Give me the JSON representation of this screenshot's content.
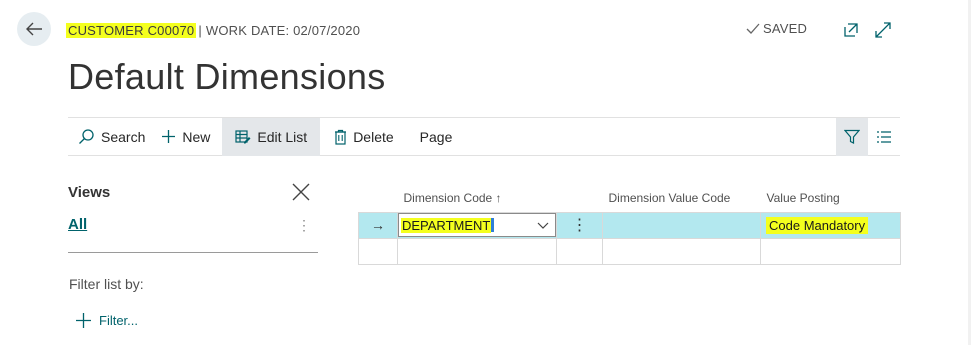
{
  "header": {
    "record_label": "CUSTOMER C00070",
    "separator": "|",
    "work_date": "WORK DATE: 02/07/2020",
    "status": "SAVED",
    "highlight_color": "#f4ff1e"
  },
  "page": {
    "title": "Default Dimensions"
  },
  "toolbar": {
    "search_label": "Search",
    "new_label": "New",
    "edit_list_label": "Edit List",
    "delete_label": "Delete",
    "page_label": "Page"
  },
  "views": {
    "title": "Views",
    "items": [
      {
        "label": "All",
        "dots": "⋮"
      }
    ],
    "filter_title": "Filter list by:",
    "filter_link": "Filter..."
  },
  "grid": {
    "columns": [
      "Dimension Code ↑",
      "Dimension Value Code",
      "Value Posting"
    ],
    "rows": [
      {
        "arrow": "→",
        "dimension_code": "DEPARTMENT",
        "dots": "⋮",
        "dimension_value_code": "",
        "value_posting": "Code Mandatory",
        "selected": true
      }
    ],
    "accent": "#00626b",
    "selected_row_color": "#b3e8ef"
  }
}
